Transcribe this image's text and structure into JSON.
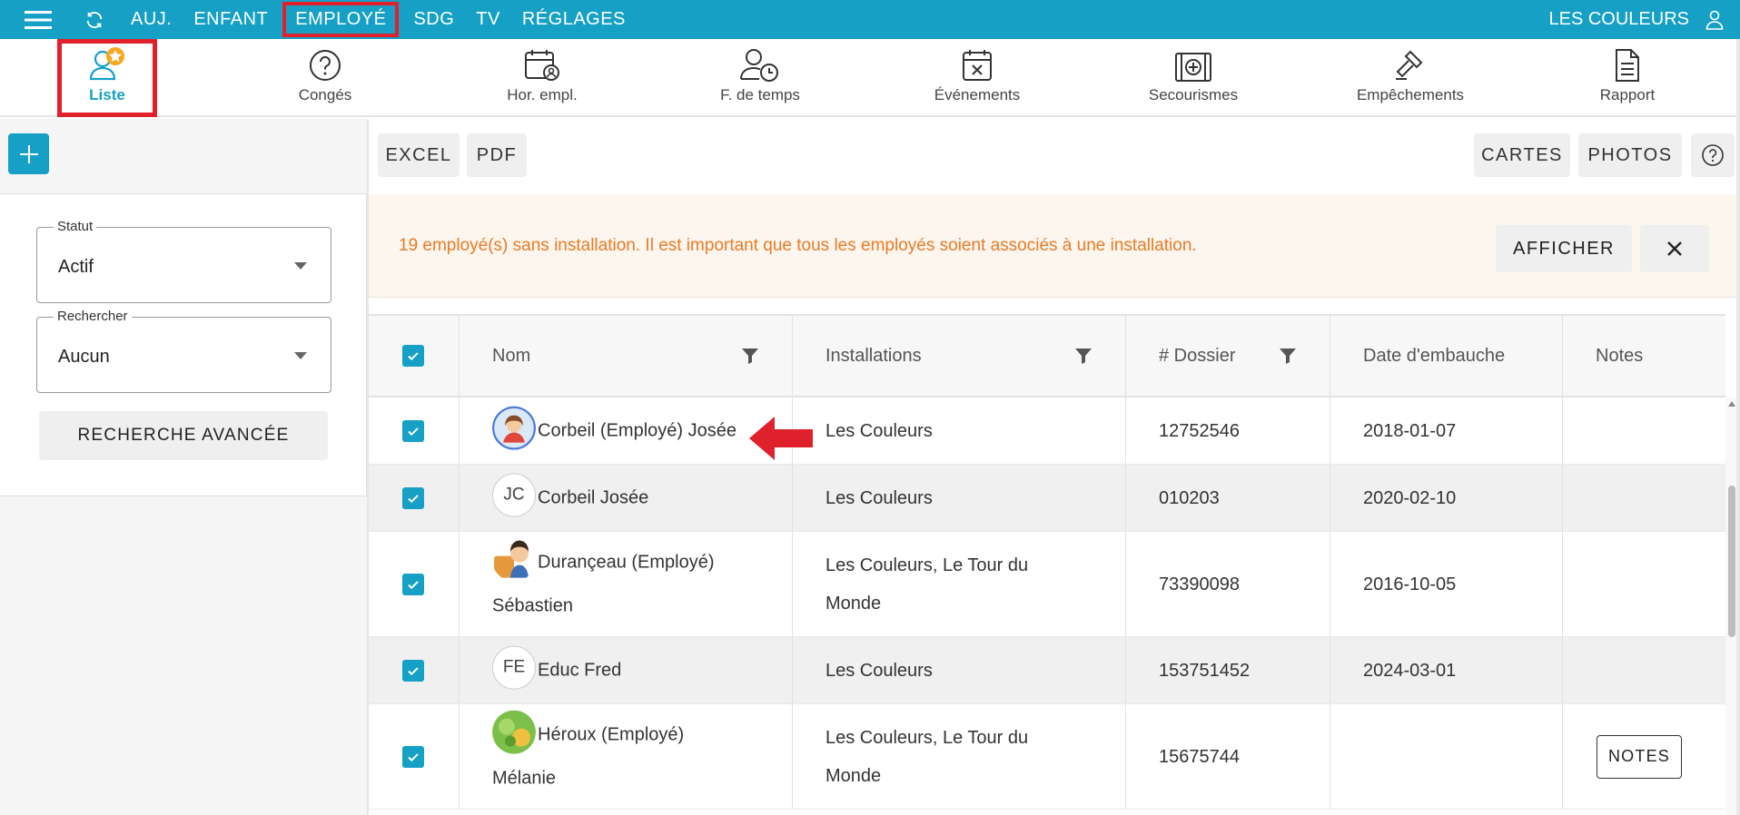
{
  "topbar": {
    "nav": [
      "AUJ.",
      "ENFANT",
      "EMPLOYÉ",
      "SDG",
      "TV",
      "RÉGLAGES"
    ],
    "active_nav": "EMPLOYÉ",
    "organization": "LES COULEURS"
  },
  "subtabs": [
    "Liste",
    "Congés",
    "Hor. empl.",
    "F. de temps",
    "Événements",
    "Secourismes",
    "Empêchements",
    "Rapport"
  ],
  "sidebar": {
    "statut": {
      "label": "Statut",
      "value": "Actif"
    },
    "rechercher": {
      "label": "Rechercher",
      "value": "Aucun"
    },
    "advanced_search": "RECHERCHE AVANCÉE"
  },
  "toolbar": {
    "excel": "EXCEL",
    "pdf": "PDF",
    "cartes": "CARTES",
    "photos": "PHOTOS"
  },
  "alert": {
    "message": "19 employé(s) sans installation. Il est important que tous les employés soient associés à une installation.",
    "action": "AFFICHER"
  },
  "table": {
    "headers": {
      "nom": "Nom",
      "installations": "Installations",
      "dossier": "# Dossier",
      "embauche": "Date d'embauche",
      "notes": "Notes"
    },
    "rows": [
      {
        "initials": "",
        "name_line1": "Corbeil (Employé) Josée",
        "name_line2": "",
        "installations_line1": "Les Couleurs",
        "installations_line2": "",
        "dossier": "12752546",
        "embauche": "2018-01-07",
        "notes": ""
      },
      {
        "initials": "JC",
        "name_line1": "Corbeil Josée",
        "name_line2": "",
        "installations_line1": "Les Couleurs",
        "installations_line2": "",
        "dossier": "010203",
        "embauche": "2020-02-10",
        "notes": ""
      },
      {
        "initials": "",
        "name_line1": "Durançeau (Employé)",
        "name_line2": "Sébastien",
        "installations_line1": "Les Couleurs, Le Tour du",
        "installations_line2": "Monde",
        "dossier": "73390098",
        "embauche": "2016-10-05",
        "notes": ""
      },
      {
        "initials": "FE",
        "name_line1": "Educ Fred",
        "name_line2": "",
        "installations_line1": "Les Couleurs",
        "installations_line2": "",
        "dossier": "153751452",
        "embauche": "2024-03-01",
        "notes": ""
      },
      {
        "initials": "",
        "name_line1": "Héroux (Employé)",
        "name_line2": "Mélanie",
        "installations_line1": "Les Couleurs, Le Tour du",
        "installations_line2": "Monde",
        "dossier": "15675744",
        "embauche": "",
        "notes": "NOTES"
      }
    ]
  }
}
